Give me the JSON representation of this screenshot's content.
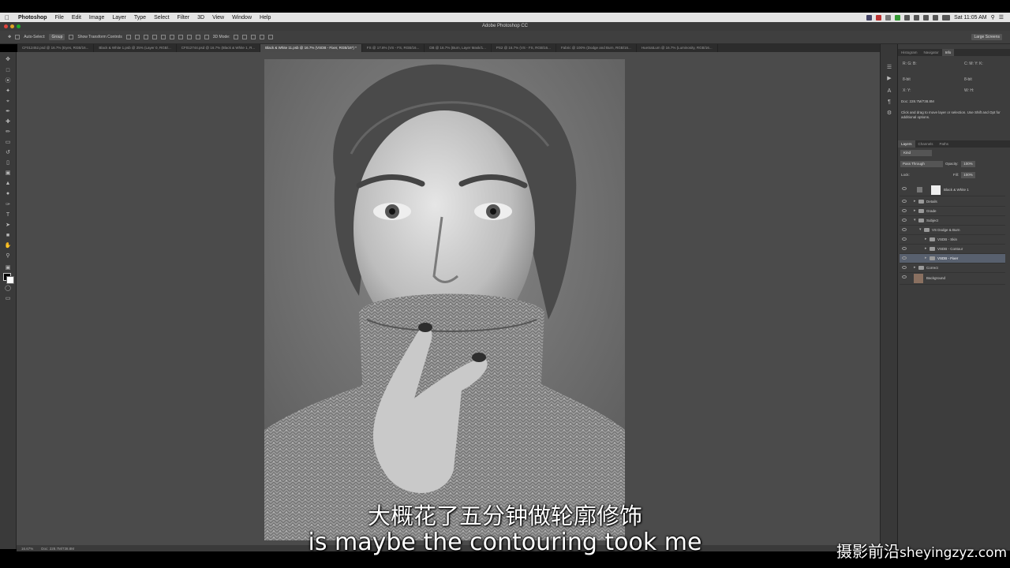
{
  "menubar": {
    "app_name": "Photoshop",
    "items": [
      "File",
      "Edit",
      "Image",
      "Layer",
      "Type",
      "Select",
      "Filter",
      "3D",
      "View",
      "Window",
      "Help"
    ],
    "clock": "Sat 11:05 AM"
  },
  "window": {
    "title": "Adobe Photoshop CC"
  },
  "options_bar": {
    "auto_select": "Auto-Select:",
    "auto_select_value": "Group",
    "transform": "Show Transform Controls",
    "mode_3d": "3D Mode:",
    "workspace": "Large Screens"
  },
  "doc_tabs": [
    "CF012452.psd @ 16.7% (Eyes, RGB/16...",
    "Black & White 1.psb @ 25% (Layer 0, RGB/...",
    "CF012744.psd @ 16.7% (Black & White 1, R...",
    "Black & White 11.psb @ 16.7% (VSDB - Fixer, RGB/16*) *",
    "FS @ 17.8% (VS - FS, RGB/16...",
    "DB @ 16.7% (Burn, Layer Mask/1...",
    "PS2 @ 16.7% (VS - FS, RGB/16...",
    "Fabric @ 100% (Dodge and Burn, RGB/16...",
    "HueSatLum @ 16.7% (Luminosity, RGB/16..."
  ],
  "active_tab_index": 3,
  "status": {
    "zoom": "16.67%",
    "doc": "Doc: 228.7M/738.8M"
  },
  "info_panel": {
    "tabs": [
      "Histogram",
      "Navigator",
      "Info"
    ],
    "active_tab": "Info",
    "doc": "Doc: 228.7M/738.8M",
    "hint": "Click and drag to move layer or selection. Use Shift and Opt for additional options."
  },
  "layers_panel": {
    "tabs": [
      "Layers",
      "Channels",
      "Paths"
    ],
    "active_tab": "Layers",
    "kind": "Kind",
    "blend_mode": "Pass Through",
    "opacity_label": "Opacity:",
    "opacity": "100%",
    "lock_label": "Lock:",
    "fill_label": "Fill:",
    "fill": "100%",
    "layers": [
      {
        "name": "Black & White 1",
        "type": "adjustment",
        "indent": 0
      },
      {
        "name": "Details",
        "type": "group",
        "indent": 0
      },
      {
        "name": "Grade",
        "type": "group",
        "indent": 0
      },
      {
        "name": "Subject",
        "type": "group-open",
        "indent": 0
      },
      {
        "name": "VS Dodge & Burn",
        "type": "group-open",
        "indent": 1
      },
      {
        "name": "VSDB - Skin",
        "type": "group",
        "indent": 2
      },
      {
        "name": "VSDB - Contour",
        "type": "group",
        "indent": 2
      },
      {
        "name": "VSDB - Fixer",
        "type": "group",
        "indent": 2,
        "selected": true
      },
      {
        "name": "Correct",
        "type": "group",
        "indent": 0
      },
      {
        "name": "Background",
        "type": "image",
        "indent": 0
      }
    ]
  },
  "subtitles": {
    "cn": "大概花了五分钟做轮廓修饰",
    "en": "is maybe the contouring took me"
  },
  "watermark": {
    "cn": "摄影前沿",
    "en": "sheyingzyz.com"
  }
}
